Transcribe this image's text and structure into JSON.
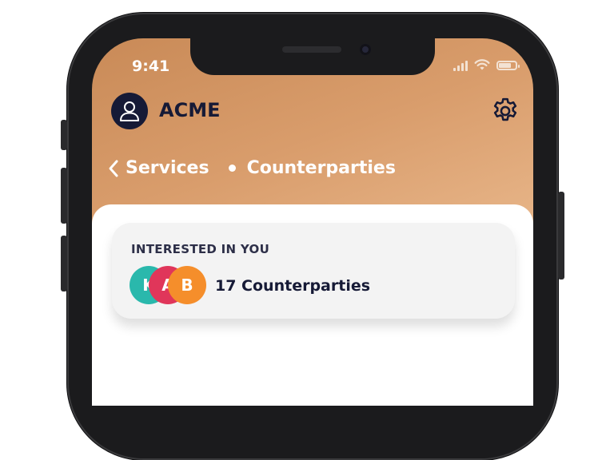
{
  "status_bar": {
    "time": "9:41"
  },
  "header": {
    "company_name": "ACME"
  },
  "breadcrumb": {
    "back_label": "Services",
    "current_label": "Counterparties"
  },
  "interest_card": {
    "title": "INTERESTED IN YOU",
    "avatars": [
      {
        "initial": "K",
        "color": "#2ab8ac"
      },
      {
        "initial": "A",
        "color": "#e0365a"
      },
      {
        "initial": "B",
        "color": "#f58e2b"
      }
    ],
    "count_label": "17 Counterparties"
  },
  "colors": {
    "brand_dark": "#161a36",
    "gradient_start": "#c98a57",
    "gradient_end": "#f0c8a3"
  },
  "icons": {
    "avatar": "user-icon",
    "settings": "gear-icon",
    "back": "chevron-left-icon",
    "signal": "cellular-signal-icon",
    "wifi": "wifi-icon",
    "battery": "battery-icon"
  },
  "battery_level": 0.85
}
